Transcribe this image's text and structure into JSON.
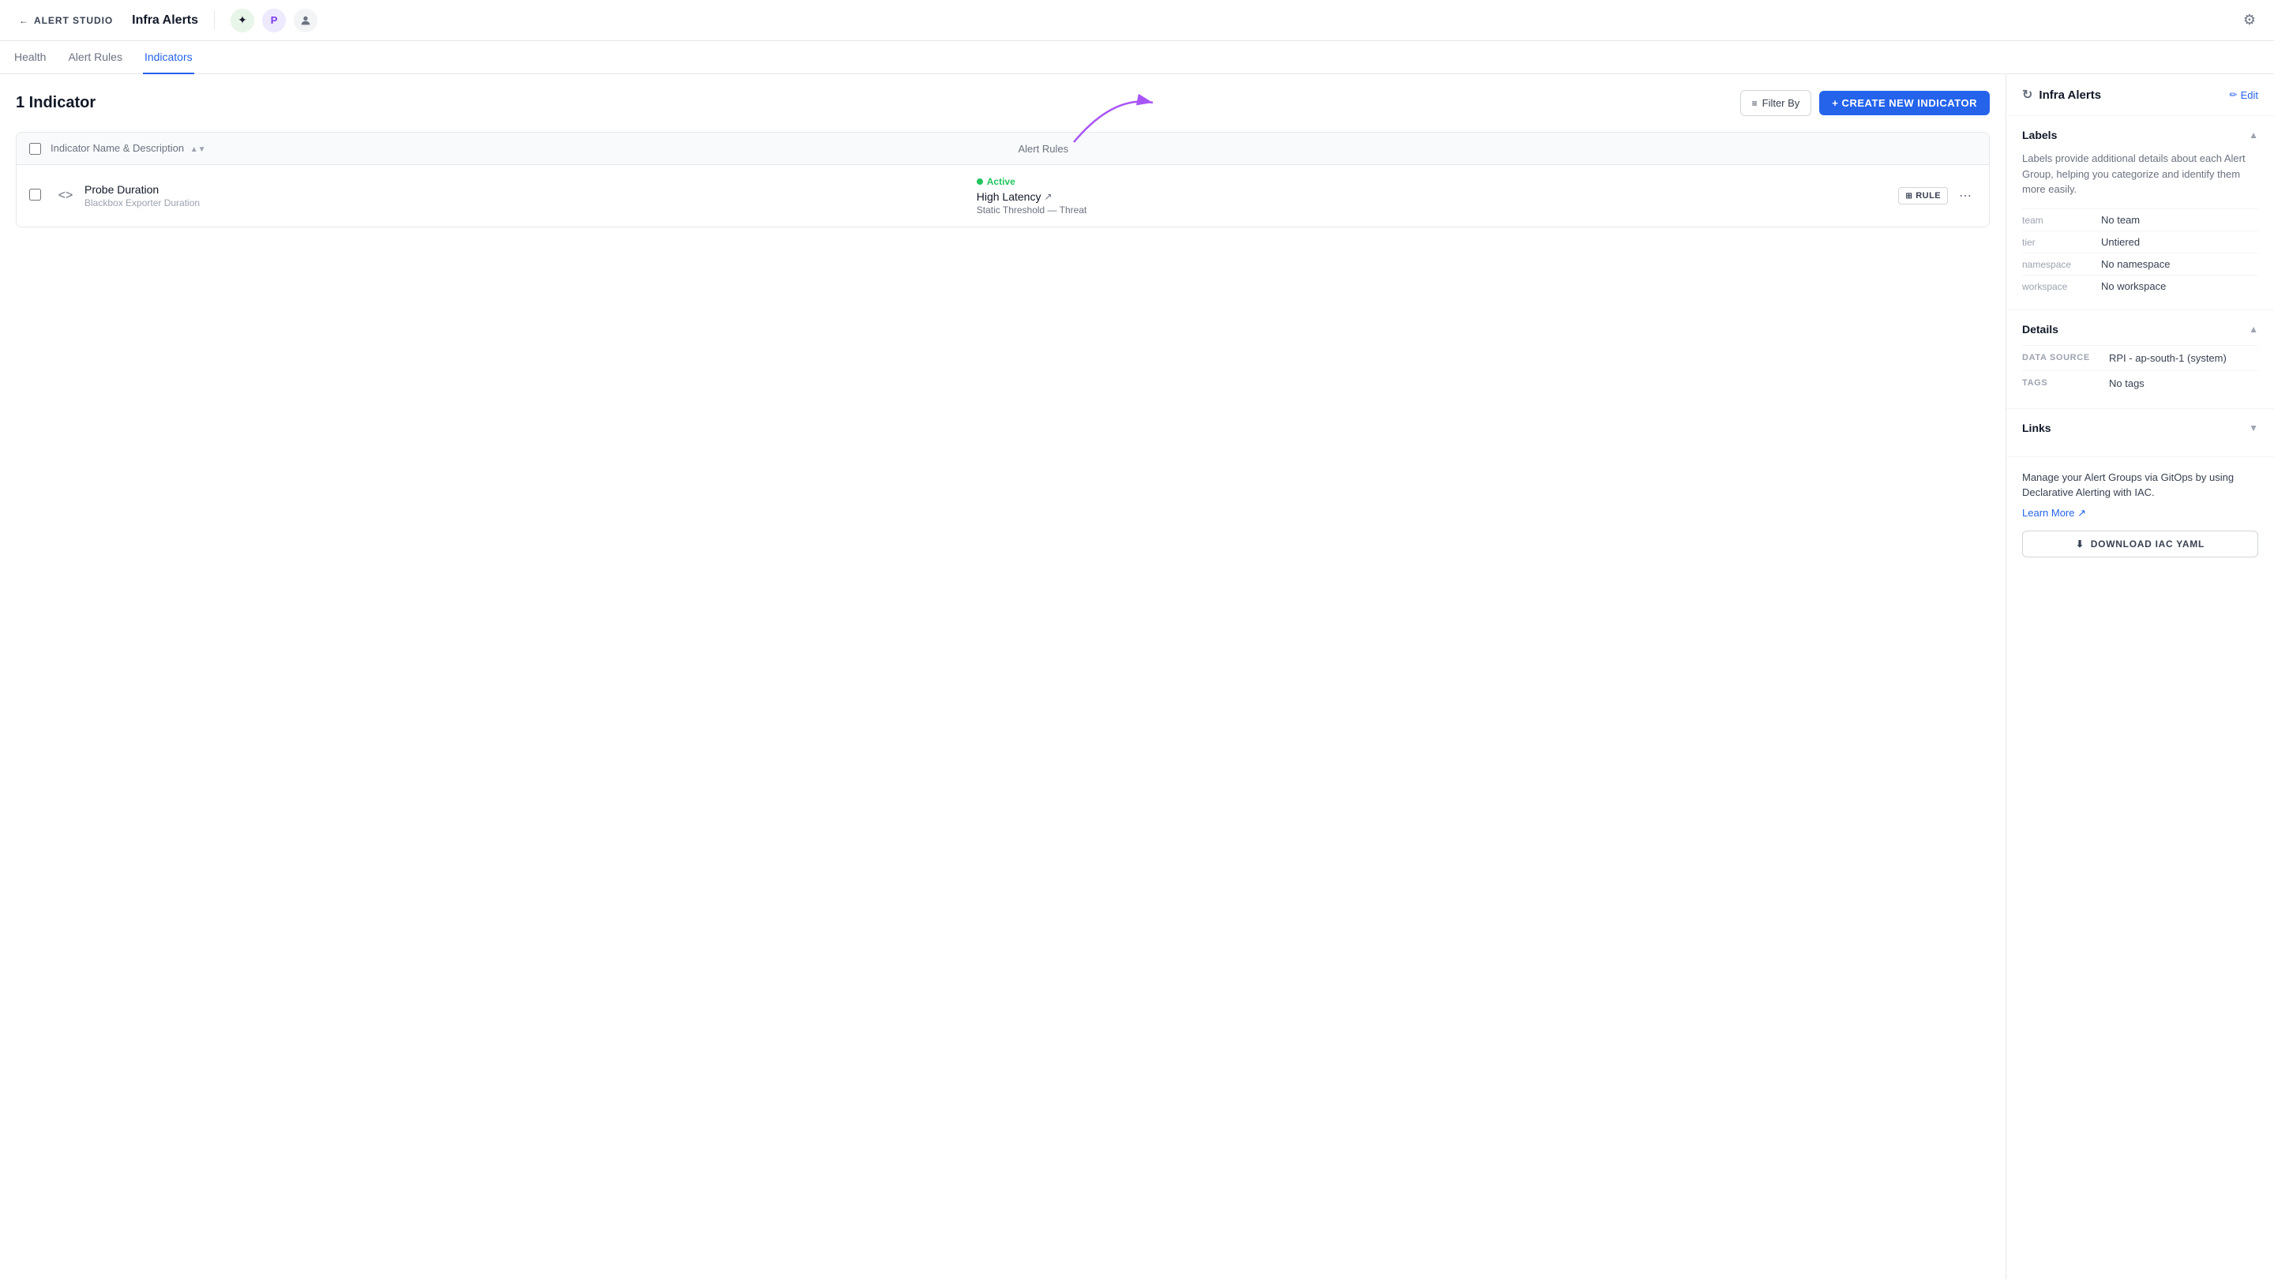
{
  "app": {
    "name": "ALERT STUDIO",
    "back_label": "ALERT STUDIO",
    "title": "Infra Alerts",
    "settings_icon": "⚙"
  },
  "top_icons": [
    {
      "id": "slack",
      "symbol": "✦",
      "type": "slack"
    },
    {
      "id": "pagerduty",
      "symbol": "P",
      "type": "purple"
    },
    {
      "id": "user",
      "symbol": "👤",
      "type": "gray"
    }
  ],
  "nav": {
    "tabs": [
      {
        "id": "health",
        "label": "Health",
        "active": false
      },
      {
        "id": "alert-rules",
        "label": "Alert Rules",
        "active": false
      },
      {
        "id": "indicators",
        "label": "Indicators",
        "active": true
      }
    ]
  },
  "main": {
    "indicator_count_label": "1 Indicator",
    "filter_btn_label": "Filter By",
    "create_btn_label": "+ CREATE NEW INDICATOR",
    "table": {
      "col_name": "Indicator Name & Description",
      "col_rules": "Alert Rules",
      "rows": [
        {
          "id": "probe-duration",
          "name": "Probe Duration",
          "description": "Blackbox Exporter Duration",
          "status": "Active",
          "rule_name": "High Latency",
          "rule_type": "Static Threshold — Threat",
          "rule_badge": "RULE"
        }
      ]
    }
  },
  "panel": {
    "title": "Infra Alerts",
    "edit_label": "Edit",
    "labels_section": {
      "title": "Labels",
      "description": "Labels provide additional details about each Alert Group, helping you categorize and identify them more easily.",
      "items": [
        {
          "key": "team",
          "value": "No team"
        },
        {
          "key": "tier",
          "value": "Untiered"
        },
        {
          "key": "namespace",
          "value": "No namespace"
        },
        {
          "key": "workspace",
          "value": "No workspace"
        }
      ]
    },
    "details_section": {
      "title": "Details",
      "items": [
        {
          "key": "DATA SOURCE",
          "value": "RPI - ap-south-1 (system)"
        },
        {
          "key": "TAGS",
          "value": "No tags"
        }
      ]
    },
    "links_section": {
      "title": "Links"
    },
    "gitops": {
      "description": "Manage your Alert Groups via GitOps by using Declarative Alerting with IAC.",
      "learn_more_label": "Learn More ↗",
      "download_label": "DOWNLOAD IAC YAML",
      "download_icon": "⬇"
    }
  }
}
